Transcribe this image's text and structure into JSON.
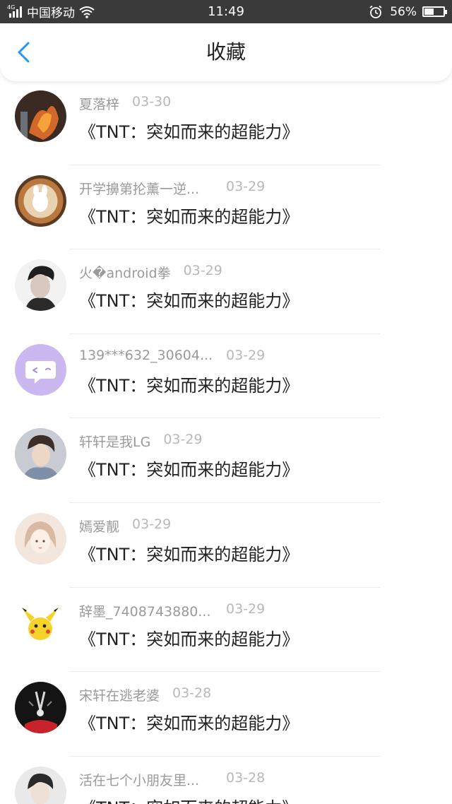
{
  "status_bar": {
    "network": "4G",
    "carrier": "中国移动",
    "time": "11:49",
    "battery": "56%",
    "battery_level": 0.56
  },
  "header": {
    "back_icon": "chevron-left-icon",
    "title": "收藏",
    "accent_color": "#2196F3"
  },
  "favorites": [
    {
      "user": "夏落梓",
      "date": "03-30",
      "work": "《TNT：突如而来的超能力》"
    },
    {
      "user": "开学擤第抡薰一逆...",
      "date": "03-29",
      "work": "《TNT：突如而来的超能力》"
    },
    {
      "user": "火�android拳",
      "date": "03-29",
      "work": "《TNT：突如而来的超能力》"
    },
    {
      "user": "139***632_30604...",
      "date": "03-29",
      "work": "《TNT：突如而来的超能力》"
    },
    {
      "user": "轩轩是我LG",
      "date": "03-29",
      "work": "《TNT：突如而来的超能力》"
    },
    {
      "user": "嫣爱靓",
      "date": "03-29",
      "work": "《TNT：突如而来的超能力》"
    },
    {
      "user": "辞墨_7408743880...",
      "date": "03-29",
      "work": "《TNT：突如而来的超能力》"
    },
    {
      "user": "宋轩在逃老婆",
      "date": "03-28",
      "work": "《TNT：突如而来的超能力》"
    },
    {
      "user": "活在七个小朋友里...",
      "date": "03-28",
      "work": "《TNT：突如而来的超能力》"
    }
  ]
}
